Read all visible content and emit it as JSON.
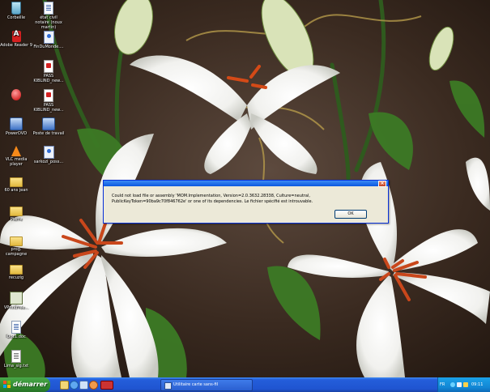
{
  "desktop": {
    "icons": [
      {
        "label": "Corbeille",
        "icon": "recycle-bin-icon"
      },
      {
        "label": "état civil notaire (noux martin)",
        "icon": "word-document-icon"
      },
      {
        "label": "Adobe Reader 9",
        "icon": "adobe-reader-icon"
      },
      {
        "label": "FinDuMonde....",
        "icon": "application-icon"
      },
      {
        "label": "PASS KIBLIND_new...",
        "icon": "pdf-file-icon"
      },
      {
        "label": "PASS KIBLIND_new...",
        "icon": "pdf-file-icon"
      },
      {
        "label": "",
        "icon": "red-orb-icon"
      },
      {
        "label": "PowerDVD",
        "icon": "powerdvd-icon"
      },
      {
        "label": "Poste de travail",
        "icon": "my-computer-icon"
      },
      {
        "label": "VLC media player",
        "icon": "vlc-icon"
      },
      {
        "label": "sarkozi_poss...",
        "icon": "application-icon"
      },
      {
        "label": "60 ans jean",
        "icon": "folder-icon"
      },
      {
        "label": "Pierre",
        "icon": "folder-icon"
      },
      {
        "label": "prog. campagne",
        "icon": "folder-icon"
      },
      {
        "label": "recuzig",
        "icon": "folder-icon"
      },
      {
        "label": "VPrintFree...",
        "icon": "shortcut-icon"
      },
      {
        "label": "Doc1.doc",
        "icon": "word-document-icon"
      },
      {
        "label": "Lima_sig.txt",
        "icon": "text-file-icon"
      }
    ]
  },
  "dialog": {
    "close_symbol": "×",
    "message": "Could not load file or assembly 'MOM.Implementation, Version=2.0.3632.28338, Culture=neutral, PublicKeyToken=90ba9c70f846762e' or one of its dependencies. Le fichier spécifié est introuvable.",
    "ok_label": "OK"
  },
  "taskbar": {
    "start_label": "démarrer",
    "task_label": "Utilitaire carte sans-fil",
    "language": "FR",
    "clock": "09:11"
  }
}
